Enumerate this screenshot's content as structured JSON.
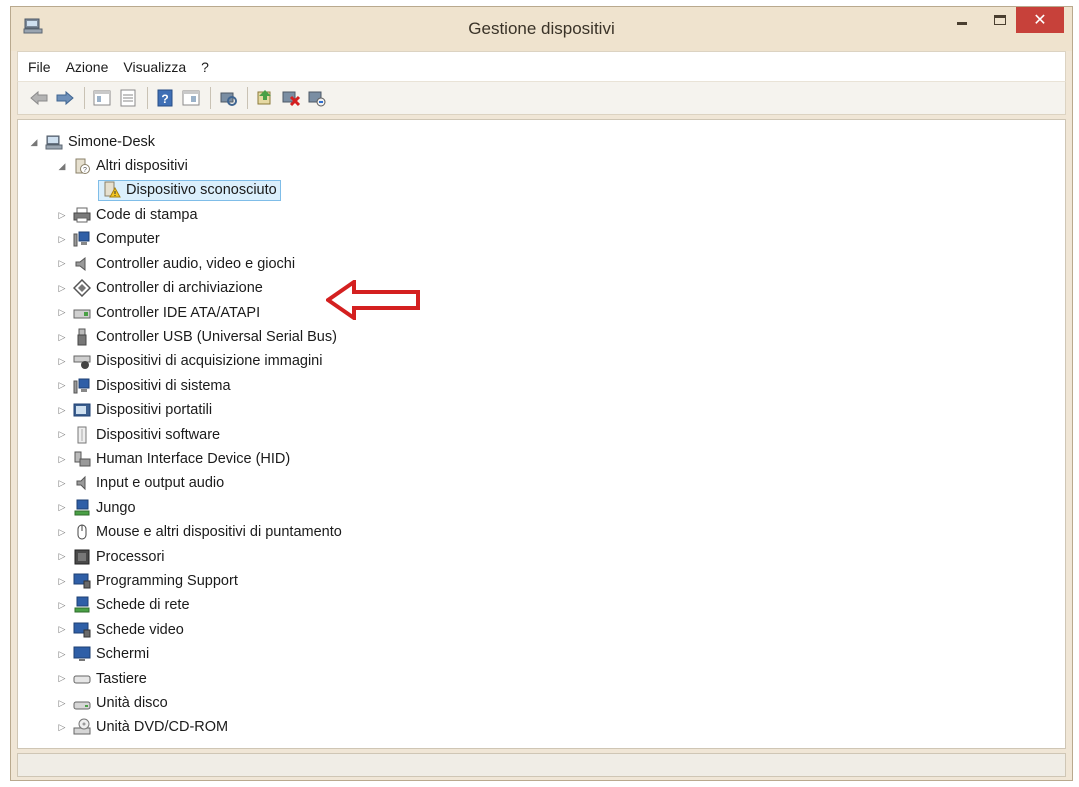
{
  "window": {
    "title": "Gestione dispositivi",
    "close_glyph": "✕"
  },
  "menu": [
    "File",
    "Azione",
    "Visualizza",
    "?"
  ],
  "toolbar": {
    "icons": [
      "back-arrow-icon",
      "forward-arrow-icon",
      "properties-view-icon",
      "device-list-icon",
      "help-icon",
      "resource-view-icon",
      "scan-hardware-icon",
      "update-driver-icon",
      "disable-device-icon",
      "uninstall-device-icon"
    ]
  },
  "tree": {
    "root": "Simone-Desk",
    "open_group": "Altri dispositivi",
    "open_child": "Dispositivo sconosciuto",
    "categories": [
      {
        "label": "Code di stampa",
        "icon": "printer-icon"
      },
      {
        "label": "Computer",
        "icon": "computer-icon"
      },
      {
        "label": "Controller audio, video e giochi",
        "icon": "speaker-icon"
      },
      {
        "label": "Controller di archiviazione",
        "icon": "storage-controller-icon"
      },
      {
        "label": "Controller IDE ATA/ATAPI",
        "icon": "ide-controller-icon"
      },
      {
        "label": "Controller USB (Universal Serial Bus)",
        "icon": "usb-icon"
      },
      {
        "label": "Dispositivi di acquisizione immagini",
        "icon": "scanner-icon"
      },
      {
        "label": "Dispositivi di sistema",
        "icon": "system-device-icon"
      },
      {
        "label": "Dispositivi portatili",
        "icon": "portable-device-icon"
      },
      {
        "label": "Dispositivi software",
        "icon": "software-device-icon"
      },
      {
        "label": "Human Interface Device (HID)",
        "icon": "hid-icon"
      },
      {
        "label": "Input e output audio",
        "icon": "audio-io-icon"
      },
      {
        "label": "Jungo",
        "icon": "network-icon"
      },
      {
        "label": "Mouse e altri dispositivi di puntamento",
        "icon": "mouse-icon"
      },
      {
        "label": "Processori",
        "icon": "processor-icon"
      },
      {
        "label": "Programming Support",
        "icon": "monitor-icon"
      },
      {
        "label": "Schede di rete",
        "icon": "network-adapter-icon"
      },
      {
        "label": "Schede video",
        "icon": "video-card-icon"
      },
      {
        "label": "Schermi",
        "icon": "display-icon"
      },
      {
        "label": "Tastiere",
        "icon": "keyboard-icon"
      },
      {
        "label": "Unità disco",
        "icon": "disk-drive-icon"
      },
      {
        "label": "Unità DVD/CD-ROM",
        "icon": "dvd-drive-icon"
      }
    ]
  },
  "colors": {
    "annotation_arrow": "#d42020",
    "selection_bg": "#dbeffc",
    "selection_border": "#7fbde8",
    "close_button": "#c7413a"
  }
}
